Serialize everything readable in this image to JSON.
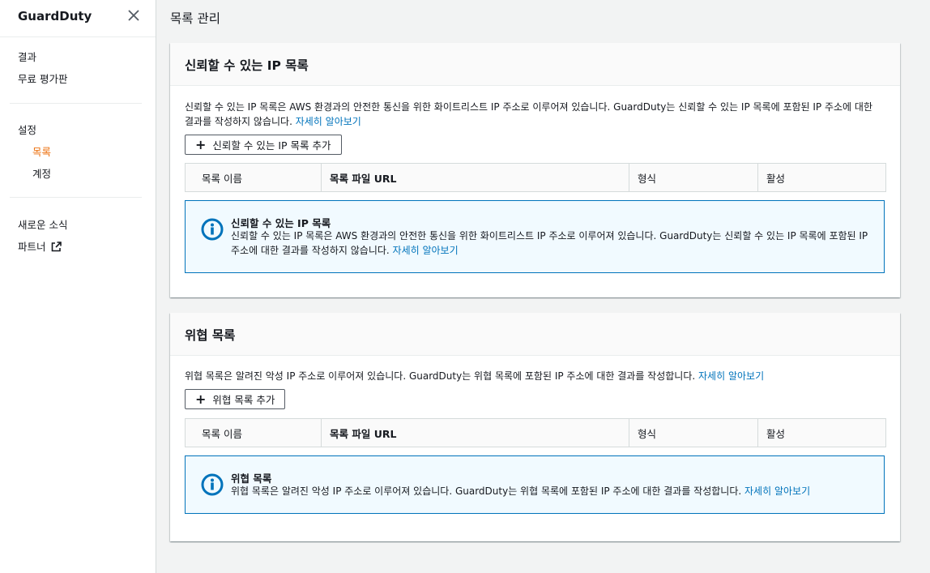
{
  "sidebar": {
    "title": "GuardDuty",
    "items": {
      "findings": "결과",
      "free_trial": "무료 평가판",
      "settings": "설정",
      "lists": "목록",
      "accounts": "계정",
      "whats_new": "새로운 소식",
      "partners": "파트너"
    },
    "active_item": "lists",
    "accent_color": "#ec7211"
  },
  "page": {
    "title": "목록 관리"
  },
  "trusted": {
    "title": "신뢰할 수 있는 IP 목록",
    "description": "신뢰할 수 있는 IP 목록은 AWS 환경과의 안전한 통신을 위한 화이트리스트 IP 주소로 이루어져 있습니다. GuardDuty는 신뢰할 수 있는 IP 목록에 포함된 IP 주소에 대한 결과를 작성하지 않습니다.",
    "learn_more": "자세히 알아보기",
    "add_button": "신뢰할 수 있는 IP 목록 추가",
    "columns": [
      "목록 이름",
      "목록 파일 URL",
      "형식",
      "활성"
    ],
    "info": {
      "title": "신뢰할 수 있는 IP 목록",
      "body": "신뢰할 수 있는 IP 목록은 AWS 환경과의 안전한 통신을 위한 화이트리스트 IP 주소로 이루어져 있습니다. GuardDuty는 신뢰할 수 있는 IP 목록에 포함된 IP 주소에 대한 결과를 작성하지 않습니다.",
      "learn_more": "자세히 알아보기"
    }
  },
  "threat": {
    "title": "위협 목록",
    "description": "위협 목록은 알려진 악성 IP 주소로 이루어져 있습니다. GuardDuty는 위협 목록에 포함된 IP 주소에 대한 결과를 작성합니다.",
    "learn_more": "자세히 알아보기",
    "add_button": "위협 목록 추가",
    "columns": [
      "목록 이름",
      "목록 파일 URL",
      "형식",
      "활성"
    ],
    "info": {
      "title": "위협 목록",
      "body": "위협 목록은 알려진 악성 IP 주소로 이루어져 있습니다. GuardDuty는 위협 목록에 포함된 IP 주소에 대한 결과를 작성합니다.",
      "learn_more": "자세히 알아보기"
    }
  },
  "colors": {
    "link": "#0073bb",
    "info_border": "#0073bb",
    "info_bg": "#f1faff"
  },
  "icons": {
    "close": "close-icon",
    "external": "external-link-icon",
    "info": "info-icon",
    "add": "plus-icon"
  }
}
